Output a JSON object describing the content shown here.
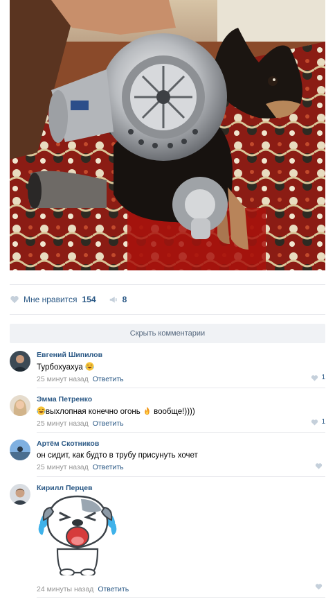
{
  "post": {
    "photo_description_icon": "photo"
  },
  "actions": {
    "like_label": "Мне нравится",
    "like_count": "154",
    "share_count": "8"
  },
  "hide_comments_label": "Скрыть комментарии",
  "comments": [
    {
      "author": "Евгений Шипилов",
      "text": "Турбохуахуа",
      "time": "25 минут назад",
      "reply": "Ответить",
      "likes": "1"
    },
    {
      "author": "Эмма Петренко",
      "text_before": "выхлопная конечно огонь ",
      "text_after": " вообще!))))",
      "time": "25 минут назад",
      "reply": "Ответить",
      "likes": "1"
    },
    {
      "author": "Артём Скотников",
      "text": "он сидит, как будто в трубу присунуть хочет",
      "time": "25 минут назад",
      "reply": "Ответить",
      "likes": ""
    },
    {
      "author": "Кирилл Перцев",
      "time": "24 минуты назад",
      "reply": "Ответить",
      "likes": ""
    }
  ],
  "colors": {
    "link": "#2a5885",
    "meta": "#939393",
    "separator": "#e7e8ec",
    "button_bg": "#f0f2f5"
  }
}
